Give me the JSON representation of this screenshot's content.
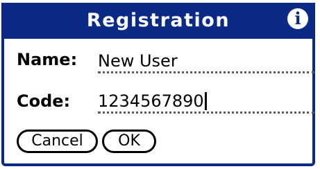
{
  "dialog": {
    "title": "Registration",
    "info_icon": "i"
  },
  "fields": {
    "name": {
      "label": "Name:",
      "value": "New User"
    },
    "code": {
      "label": "Code:",
      "value": "1234567890"
    }
  },
  "buttons": {
    "cancel": "Cancel",
    "ok": "OK"
  },
  "colors": {
    "title_bar": "#0a2a86",
    "title_text": "#ffffff",
    "field_underline": "#5a5a5a"
  },
  "icons": {
    "info": "info-icon"
  }
}
